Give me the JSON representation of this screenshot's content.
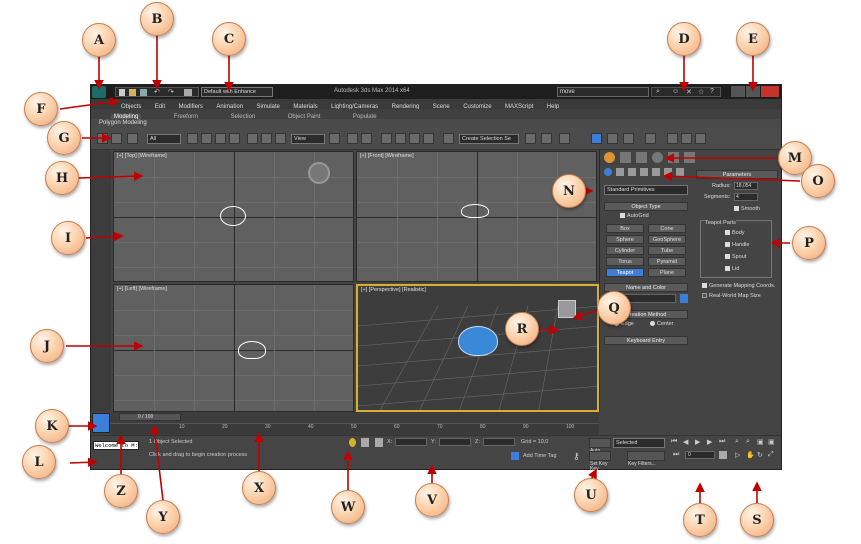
{
  "app": {
    "title": "Autodesk 3ds Max 2014 x64",
    "workspace": "Default with Enhance",
    "search_placeholder": "Type a keyword or phrase",
    "search_value": "move"
  },
  "menu": [
    "Objects",
    "Edit",
    "Modifiers",
    "Animation",
    "Simulate",
    "Materials",
    "Lighting/Cameras",
    "Rendering",
    "Scene",
    "Customize",
    "MAXScript",
    "Help"
  ],
  "ribbon": {
    "tabs": [
      "Modeling",
      "Freeform",
      "Selection",
      "Object Paint",
      "Populate"
    ],
    "subtitle": "Polygon Modeling"
  },
  "toolbar": {
    "filter": "All",
    "ref_coord": "View",
    "selection_set": "Create Selection Se"
  },
  "viewports": {
    "top": "[+] [Top] [Wireframe]",
    "front": "[+] [Front] [Wireframe]",
    "left": "[+] [Left] [Wireframe]",
    "perspective": "[+] [Perspective] [Realistic]"
  },
  "command_panel": {
    "category": "Standard Primitives",
    "object_type_header": "Object Type",
    "autogrid": "AutoGrid",
    "buttons": [
      "Box",
      "Cone",
      "Sphere",
      "GeoSphere",
      "Cylinder",
      "Tube",
      "Torus",
      "Pyramid",
      "Teapot",
      "Plane"
    ],
    "active_button": "Teapot",
    "name_color_header": "Name and Color",
    "creation_method_header": "Creation Method",
    "creation_edge": "Edge",
    "creation_center": "Center",
    "keyboard_entry_header": "Keyboard Entry"
  },
  "parameters": {
    "header": "Parameters",
    "radius_label": "Radius:",
    "radius_value": "18,054",
    "segments_label": "Segments:",
    "segments_value": "4",
    "smooth": "Smooth",
    "teapot_parts": "Teapot Parts",
    "parts": [
      "Body",
      "Handle",
      "Spout",
      "Lid"
    ],
    "gen_mapping": "Generate Mapping Coords.",
    "real_world": "Real-World Map Size"
  },
  "timeline": {
    "slider": "0 / 100",
    "ticks": [
      "10",
      "20",
      "30",
      "40",
      "50",
      "60",
      "70",
      "80",
      "90",
      "100"
    ]
  },
  "status": {
    "maxscript": "Welcome to M:",
    "selected": "1 Object Selected",
    "prompt": "Click and drag to begin creation process",
    "x_label": "X:",
    "y_label": "Y:",
    "z_label": "Z:",
    "grid": "Grid = 10,0",
    "add_time_tag": "Add Time Tag",
    "auto_key": "Auto Key",
    "set_key": "Set Key",
    "key_mode": "Selected",
    "key_filters": "Key Filters...",
    "frame": "0"
  },
  "callouts": [
    "A",
    "B",
    "C",
    "D",
    "E",
    "F",
    "G",
    "H",
    "I",
    "J",
    "K",
    "L",
    "M",
    "N",
    "O",
    "P",
    "Q",
    "R",
    "S",
    "T",
    "U",
    "V",
    "W",
    "X",
    "Y",
    "Z"
  ],
  "colors": {
    "callout_fill": "#f8c9a0",
    "active_blue": "#3c7ed8",
    "viewport_gray": "#606060",
    "perspective_border": "#d8b030"
  }
}
